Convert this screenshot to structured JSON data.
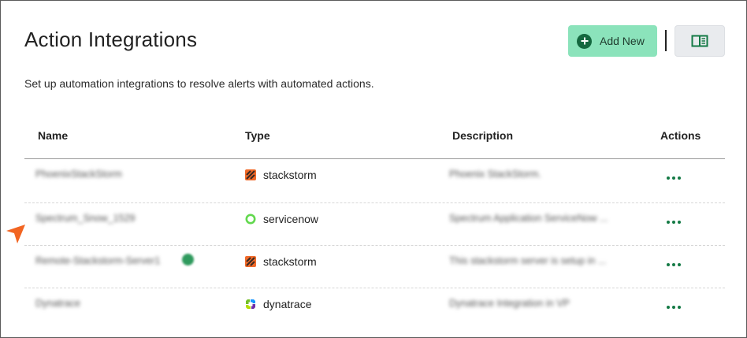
{
  "page": {
    "title": "Action Integrations",
    "subtitle": "Set up automation integrations to resolve alerts with automated actions."
  },
  "toolbar": {
    "add_label": "Add New",
    "add_icon": "plus-circle-icon",
    "docs_icon": "book-icon"
  },
  "table": {
    "columns": [
      "Name",
      "Type",
      "Description",
      "Actions"
    ],
    "rows": [
      {
        "name": "PhoenixStackStorm",
        "type": "stackstorm",
        "type_icon": "stackstorm-icon",
        "description": "Phoenix StackStorm."
      },
      {
        "name": "Spectrum_Snow_1529",
        "type": "servicenow",
        "type_icon": "servicenow-icon",
        "description": "Spectrum Application ServiceNow ..."
      },
      {
        "name": "Remote-Stackstorm-Server1",
        "type": "stackstorm",
        "type_icon": "stackstorm-icon",
        "description": "This stackstorm server is setup in ..."
      },
      {
        "name": "Dynatrace",
        "type": "dynatrace",
        "type_icon": "dynatrace-icon",
        "description": "Dynatrace Integration in VP"
      }
    ]
  },
  "colors": {
    "accent_green": "#8be3bb",
    "action_green": "#147a45",
    "stackstorm_orange": "#f06a2a",
    "servicenow_green": "#62d84e",
    "cursor_orange": "#f26522"
  }
}
